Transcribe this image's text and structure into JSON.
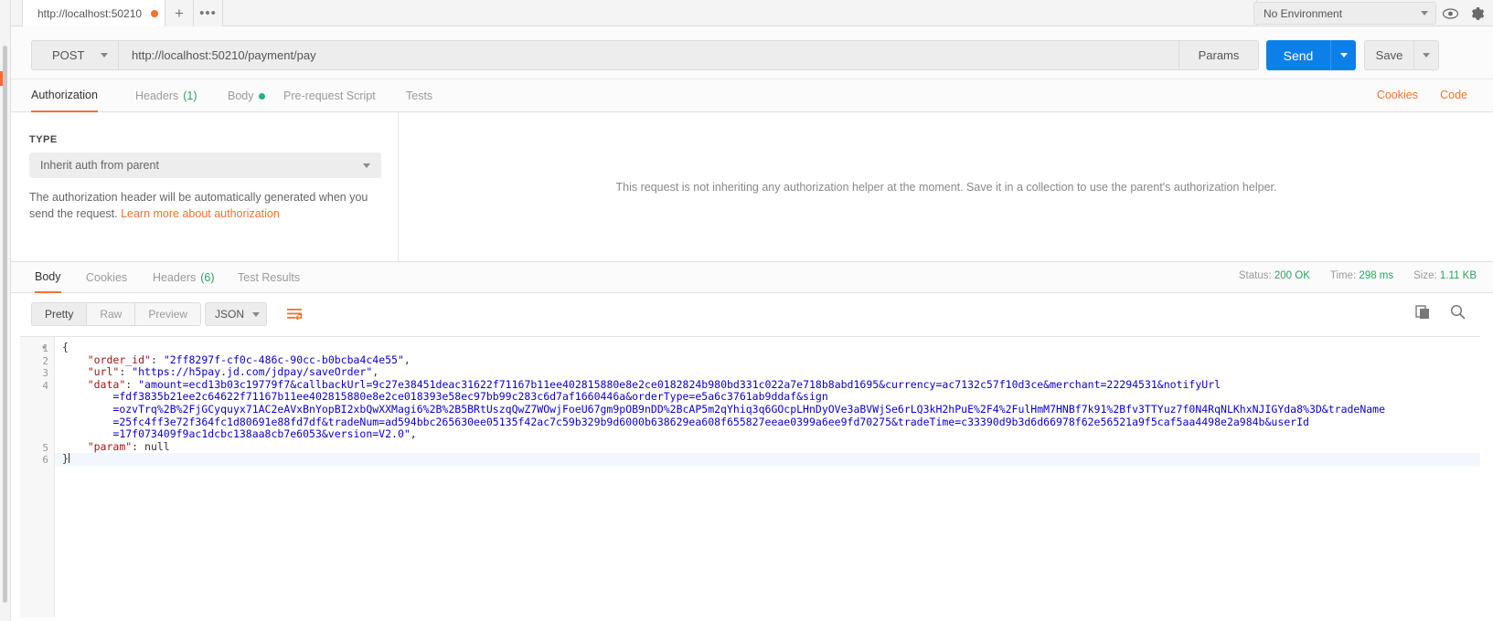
{
  "tabbar": {
    "tab_title": "http://localhost:50210",
    "unsaved_icon": "unsaved-dot-icon",
    "add_label": "+",
    "more_label": "•••",
    "environment": "No Environment",
    "eye_icon": "eye-icon",
    "gear_icon": "gear-icon"
  },
  "request": {
    "method": "POST",
    "url": "http://localhost:50210/payment/pay",
    "params_label": "Params",
    "send_label": "Send",
    "save_label": "Save"
  },
  "request_tabs": [
    {
      "label": "Authorization",
      "badge": "",
      "active": true
    },
    {
      "label": "Headers",
      "badge": "(1)",
      "active": false
    },
    {
      "label": "Body",
      "badge": "",
      "dot": true,
      "active": false
    },
    {
      "label": "Pre-request Script",
      "badge": "",
      "active": false
    },
    {
      "label": "Tests",
      "badge": "",
      "active": false
    }
  ],
  "links": {
    "cookies": "Cookies",
    "code": "Code"
  },
  "auth": {
    "type_label": "TYPE",
    "type_value": "Inherit auth from parent",
    "description_1": "The authorization header will be automatically generated when you send the request. ",
    "description_link": "Learn more about authorization",
    "right_note": "This request is not inheriting any authorization helper at the moment. Save it in a collection to use the parent's authorization helper."
  },
  "response_tabs": [
    {
      "label": "Body",
      "badge": "",
      "active": true
    },
    {
      "label": "Cookies",
      "badge": "",
      "active": false
    },
    {
      "label": "Headers",
      "badge": "(6)",
      "active": false
    },
    {
      "label": "Test Results",
      "badge": "",
      "active": false
    }
  ],
  "response_meta": {
    "status_label": "Status:",
    "status_value": "200 OK",
    "time_label": "Time:",
    "time_value": "298 ms",
    "size_label": "Size:",
    "size_value": "1.11 KB"
  },
  "body_toolbar": {
    "pretty": "Pretty",
    "raw": "Raw",
    "preview": "Preview",
    "format": "JSON",
    "wrap_icon": "word-wrap-icon",
    "copy_icon": "copy-icon",
    "search_icon": "search-icon"
  },
  "colors": {
    "accent_orange": "#f3722c",
    "send_blue": "#0d7fe8",
    "status_green": "#2d9f5f",
    "json_key": "#a31515",
    "json_string": "#0b00c8"
  },
  "response_body": {
    "line_numbers": [
      "1",
      "2",
      "3",
      "4",
      "5",
      "6"
    ],
    "json": {
      "order_id": "2ff8297f-cf0c-486c-90cc-b0bcba4c4e55",
      "url": "https://h5pay.jd.com/jdpay/saveOrder",
      "data": "amount=ecd13b03c19779f7&callbackUrl=9c27e38451deac31622f71167b11ee402815880e8e2ce0182824b980bd331c022a7e718b8abd1695&currency=ac7132c57f10d3ce&merchant=22294531&notifyUrl=fdf3835b21ee2c64622f71167b11ee402815880e8e2ce018393e58ec97bb99c283c6d7af1660446a&orderType=e5a6c3761ab9ddaf&sign=ozvTrq%2B%2FjGCyquyx71AC2eAVxBnYopBI2xbQwXXMagi6%2B%2B5BRtUszqQwZ7WOwjFoeU67gm9pOB9nDD%2BcAP5m2qYhiq3q6GOcpLHnDyOVe3aBVWjSe6rLQ3kH2hPuE%2F4%2FulHmM7HNBf7k91%2Bfv3TTYuz7f0N4RqNLKhxNJIGYda8%3D&tradeName=25fc4ff3e72f364fc1d80691e88fd7df&tradeNum=ad594bbc265630ee05135f42ac7c59b329b9d6000b638629ea608f655827eeae0399a6ee9fd70275&tradeTime=c33390d9b3d6d66978f62e56521a9f5caf5aa4498e2a984b&userId=17f073409f9ac1dcbc138aa8cb7e6053&version=V2.0",
      "param": null
    },
    "rendered_rows": [
      {
        "indent": 0,
        "text": "{",
        "type": "brace"
      },
      {
        "indent": 1,
        "key": "\"order_id\"",
        "value": "\"2ff8297f-cf0c-486c-90cc-b0bcba4c4e55\"",
        "comma": true
      },
      {
        "indent": 1,
        "key": "\"url\"",
        "value": "\"https://h5pay.jd.com/jdpay/saveOrder\"",
        "comma": true
      },
      {
        "indent": 1,
        "key": "\"data\"",
        "value": "\"amount=ecd13b03c19779f7&callbackUrl=9c27e38451deac31622f71167b11ee402815880e8e2ce0182824b980bd331c022a7e718b8abd1695&currency=ac7132c57f10d3ce&merchant=22294531&notifyUrl",
        "comma": false
      },
      {
        "indent": 1,
        "key": "\"param\"",
        "value": "null",
        "comma": false
      },
      {
        "indent": 0,
        "text": "}",
        "type": "brace"
      }
    ],
    "wrapped_segments": [
      "=fdf3835b21ee2c64622f71167b11ee402815880e8e2ce018393e58ec97bb99c283c6d7af1660446a&orderType=e5a6c3761ab9ddaf&sign",
      "=ozvTrq%2B%2FjGCyquyx71AC2eAVxBnYopBI2xbQwXXMagi6%2B%2B5BRtUszqQwZ7WOwjFoeU67gm9pOB9nDD%2BcAP5m2qYhiq3q6GOcpLHnDyOVe3aBVWjSe6rLQ3kH2hPuE%2F4%2FulHmM7HNBf7k91%2Bfv3TTYuz7f0N4RqNLKhxNJIGYda8%3D&tradeName",
      "=25fc4ff3e72f364fc1d80691e88fd7df&tradeNum=ad594bbc265630ee05135f42ac7c59b329b9d6000b638629ea608f655827eeae0399a6ee9fd70275&tradeTime=c33390d9b3d6d66978f62e56521a9f5caf5aa4498e2a984b&userId",
      "=17f073409f9ac1dcbc138aa8cb7e6053&version=V2.0\","
    ]
  }
}
